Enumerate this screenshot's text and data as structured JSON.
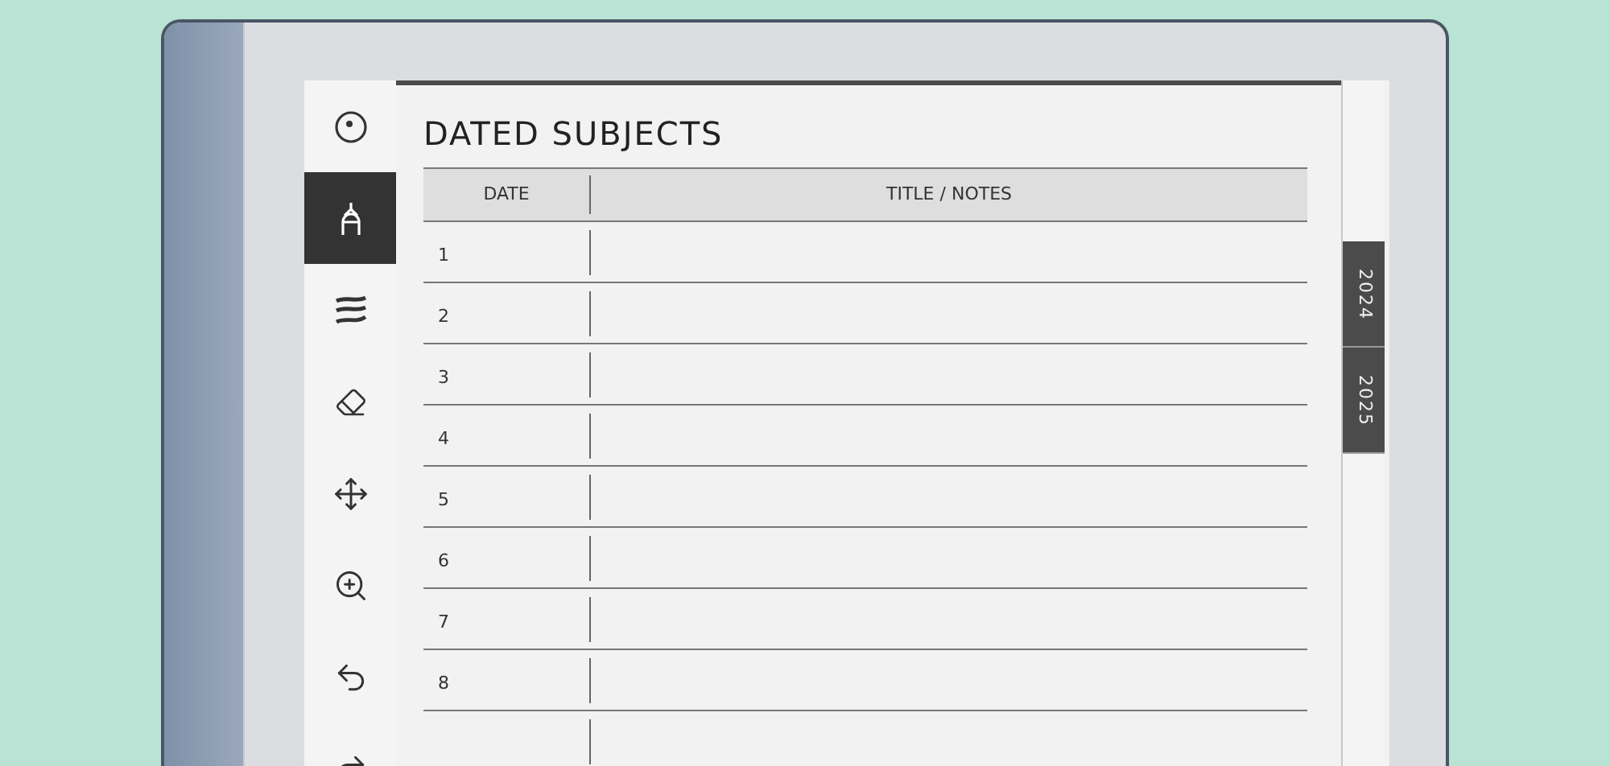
{
  "toolbar": [
    {
      "kind": "menu",
      "selected": false
    },
    {
      "kind": "pen",
      "selected": true
    },
    {
      "kind": "strokes",
      "selected": false
    },
    {
      "kind": "eraser",
      "selected": false
    },
    {
      "kind": "move",
      "selected": false
    },
    {
      "kind": "zoom",
      "selected": false
    },
    {
      "kind": "undo",
      "selected": false
    },
    {
      "kind": "redo",
      "selected": false
    }
  ],
  "page": {
    "title": "DATED SUBJECTS",
    "columns": [
      "DATE",
      "TITLE / NOTES"
    ],
    "rows": [
      {
        "date": "1"
      },
      {
        "date": "2"
      },
      {
        "date": "3"
      },
      {
        "date": "4"
      },
      {
        "date": "5"
      },
      {
        "date": "6"
      },
      {
        "date": "7"
      },
      {
        "date": "8"
      }
    ]
  },
  "year_tabs": [
    {
      "label": "2024"
    },
    {
      "label": "2025"
    }
  ]
}
